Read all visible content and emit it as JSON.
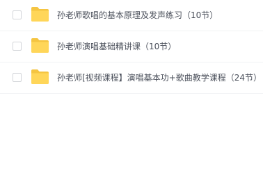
{
  "file_list": {
    "items": [
      {
        "name": "孙老师歌唱的基本原理及发声练习（10节）",
        "type_icon": "folder-icon",
        "checked": false
      },
      {
        "name": "孙老师演唱基础精讲课（10节）",
        "type_icon": "folder-icon",
        "checked": false
      },
      {
        "name": "孙老师[视频课程】演唱基本功+歌曲教学课程（24节）",
        "type_icon": "folder-icon",
        "checked": false
      }
    ]
  },
  "colors": {
    "folder_back": "#f5c542",
    "folder_front": "#ffd659",
    "text": "#4a4f5a",
    "checkbox_border": "#d4d6da",
    "row_divider": "#f1f2f4"
  }
}
